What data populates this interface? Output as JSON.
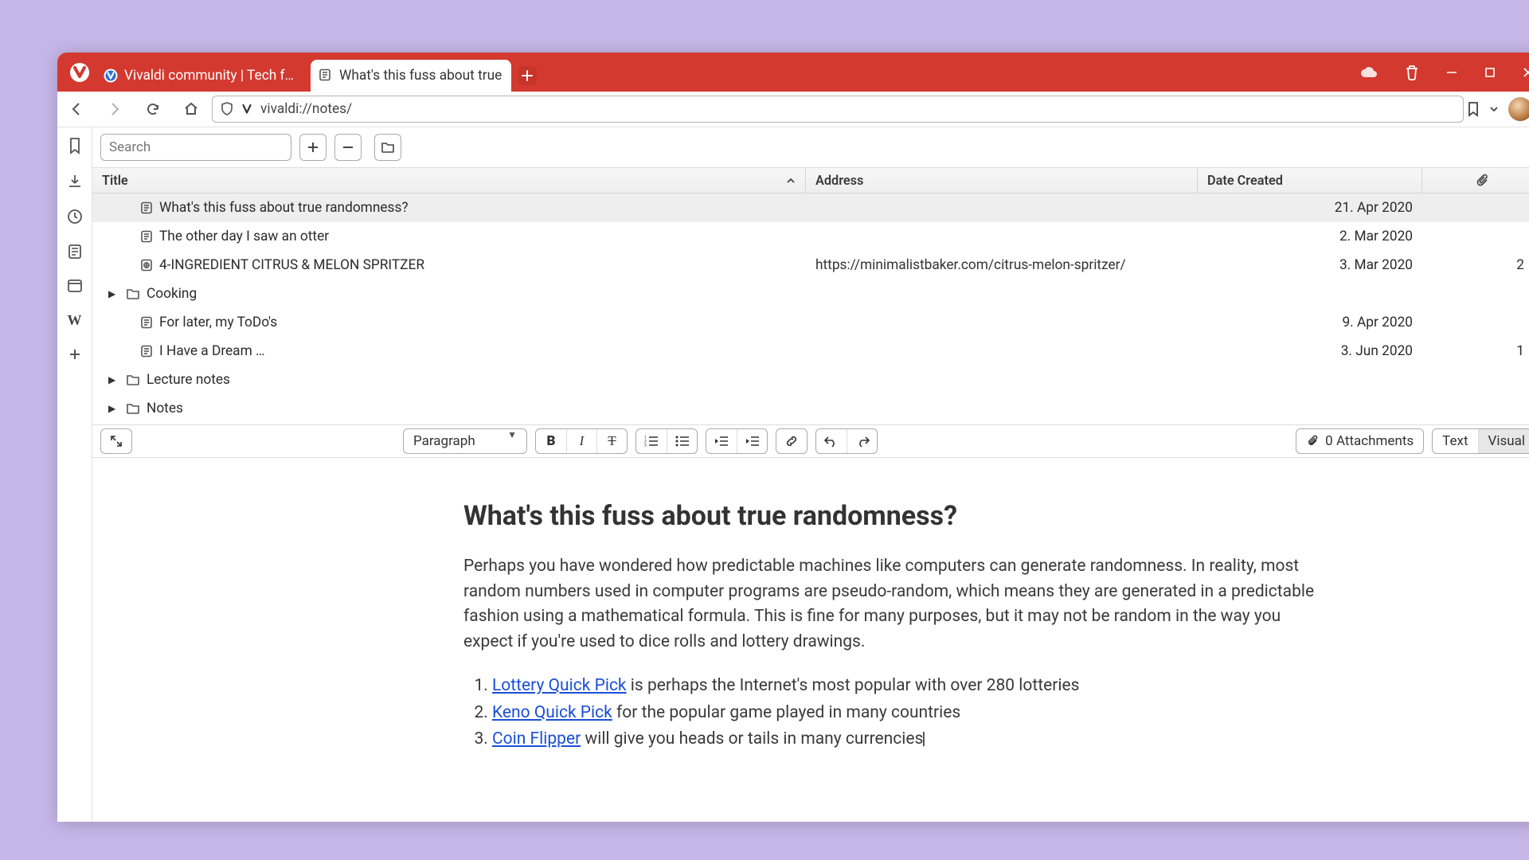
{
  "tabs": [
    {
      "title": "Vivaldi community | Tech forum",
      "active": false
    },
    {
      "title": "What's this fuss about true",
      "active": true
    }
  ],
  "addressbar": {
    "url": "vivaldi://notes/"
  },
  "sidebar_search": {
    "placeholder": "Search"
  },
  "list": {
    "columns": {
      "title": "Title",
      "address": "Address",
      "date": "Date Created"
    },
    "rows": [
      {
        "type": "note",
        "title": "What's this fuss about true randomness?",
        "address": "",
        "date": "21. Apr 2020",
        "att": "",
        "selected": true,
        "indent": 1,
        "icon": "note"
      },
      {
        "type": "note",
        "title": "The other day I saw an otter",
        "address": "",
        "date": "2. Mar 2020",
        "att": "",
        "selected": false,
        "indent": 1,
        "icon": "note"
      },
      {
        "type": "note",
        "title": "4-INGREDIENT CITRUS & MELON SPRITZER",
        "address": "https://minimalistbaker.com/citrus-melon-spritzer/",
        "date": "3. Mar 2020",
        "att": "2",
        "selected": false,
        "indent": 1,
        "icon": "note-web"
      },
      {
        "type": "folder",
        "title": "Cooking",
        "address": "",
        "date": "",
        "att": "",
        "selected": false,
        "indent": 0,
        "icon": "folder"
      },
      {
        "type": "note",
        "title": "For later, my ToDo's",
        "address": "",
        "date": "9. Apr 2020",
        "att": "",
        "selected": false,
        "indent": 1,
        "icon": "note"
      },
      {
        "type": "note",
        "title": "I Have a Dream …",
        "address": "",
        "date": "3. Jun 2020",
        "att": "1",
        "selected": false,
        "indent": 1,
        "icon": "note"
      },
      {
        "type": "folder",
        "title": "Lecture notes",
        "address": "",
        "date": "",
        "att": "",
        "selected": false,
        "indent": 0,
        "icon": "folder"
      },
      {
        "type": "folder",
        "title": "Notes",
        "address": "",
        "date": "",
        "att": "",
        "selected": false,
        "indent": 0,
        "icon": "folder"
      }
    ]
  },
  "editor_toolbar": {
    "block_label": "Paragraph",
    "attachments_label": "0 Attachments",
    "mode_text": "Text",
    "mode_visual": "Visual"
  },
  "note": {
    "title": "What's this fuss about true randomness?",
    "paragraph": "Perhaps you have wondered how predictable machines like computers can generate randomness. In reality, most random numbers used in computer programs are pseudo-random, which means they are generated in a predictable fashion using a mathematical formula. This is fine for many purposes, but it may not be random in the way you expect if you're used to dice rolls and lottery drawings.",
    "items": [
      {
        "link": "Lottery Quick Pick",
        "rest": " is perhaps the Internet's most popular with over 280 lotteries"
      },
      {
        "link": "Keno Quick Pick",
        "rest": " for the popular game played in many countries"
      },
      {
        "link": "Coin Flipper",
        "rest": " will give you heads or tails in many currencies"
      }
    ]
  }
}
